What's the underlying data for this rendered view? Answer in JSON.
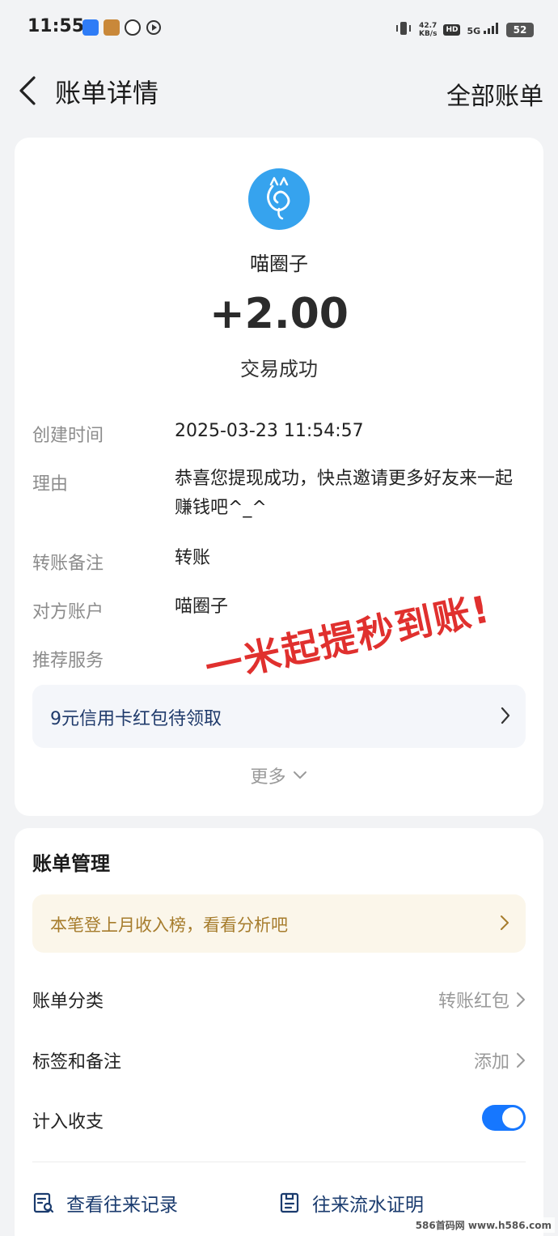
{
  "status_bar": {
    "time": "11:55",
    "net_speed_value": "42.7",
    "net_speed_unit": "KB/s",
    "hd": "HD",
    "signal": "5G",
    "battery": "52"
  },
  "nav": {
    "title": "账单详情",
    "right_action": "全部账单"
  },
  "summary": {
    "merchant": "喵圈子",
    "amount": "+2.00",
    "status": "交易成功"
  },
  "details": {
    "create_time_label": "创建时间",
    "create_time_value": "2025-03-23 11:54:57",
    "reason_label": "理由",
    "reason_value": "恭喜您提现成功，快点邀请更多好友来一起赚钱吧^_^",
    "remark_label": "转账备注",
    "remark_value": "转账",
    "counterparty_label": "对方账户",
    "counterparty_value": "喵圈子",
    "service_label": "推荐服务"
  },
  "overlay_text": "一米起提秒到账!",
  "promo": {
    "text": "9元信用卡红包待领取"
  },
  "more": "更多",
  "management": {
    "title": "账单管理",
    "tip": "本笔登上月收入榜，看看分析吧",
    "category_label": "账单分类",
    "category_value": "转账红包",
    "tags_label": "标签和备注",
    "tags_value": "添加",
    "include_label": "计入收支",
    "include_on": true,
    "action_records": "查看往来记录",
    "action_proof": "往来流水证明"
  },
  "watermark": "586首码网 www.h586.com",
  "colors": {
    "accent": "#1677ff",
    "logo_bg": "#36a3ee",
    "overlay_red": "#e0302e",
    "tip_text": "#a67c2c",
    "tip_bg": "#fbf6ea"
  }
}
